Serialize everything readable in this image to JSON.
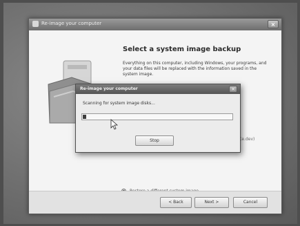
{
  "colors": {
    "background": "#4e4e4e",
    "window_title_bar": "#8a8a8a",
    "dialog_title_bar": "#666666",
    "panel": "#f4f4f4",
    "progress_fill": "#3e3e3e"
  },
  "wizard": {
    "title": "Re-image your computer",
    "close_glyph": "×",
    "heading": "Select a system image backup",
    "description": "Everything on this computer, including Windows, your programs, and your data files will be replaced with the information saved in the system image.",
    "partial_text": "(e.dev)",
    "restore_option_label": "Restore a different system image",
    "buttons": {
      "back": "< Back",
      "next": "Next >",
      "cancel": "Cancel"
    }
  },
  "modal": {
    "title": "Re-image your computer",
    "close_glyph": "×",
    "scanning_text": "Scanning for system image disks...",
    "progress_fraction": 0.03,
    "stop_label": "Stop"
  }
}
